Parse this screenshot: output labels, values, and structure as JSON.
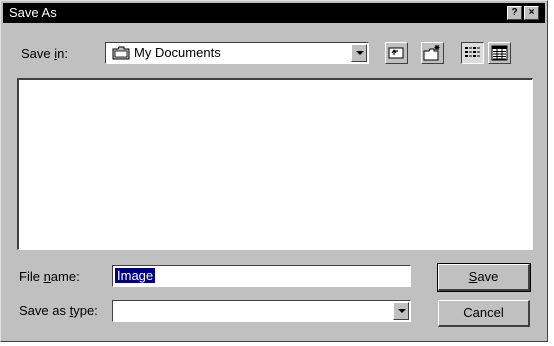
{
  "window": {
    "title": "Save As",
    "help_button": "?",
    "close_button": "×"
  },
  "save_in": {
    "label_pre": "Save ",
    "label_accel": "i",
    "label_post": "n:",
    "value": "My Documents",
    "icon": "folder-icon"
  },
  "toolbar": {
    "up_one_level_icon": "up-folder-icon",
    "new_folder_icon": "new-folder-icon",
    "list_view_icon": "list-view-icon",
    "details_view_icon": "details-view-icon"
  },
  "file_name": {
    "label_pre": "File ",
    "label_accel": "n",
    "label_post": "ame:",
    "value": "Image"
  },
  "save_as_type": {
    "label_pre": "Save as ",
    "label_accel": "t",
    "label_post": "ype:",
    "value": ""
  },
  "buttons": {
    "save_accel": "S",
    "save_rest": "ave",
    "cancel": "Cancel"
  },
  "colors": {
    "title_bar": "#000000",
    "face": "#c0c0c0",
    "selection": "#000080"
  }
}
